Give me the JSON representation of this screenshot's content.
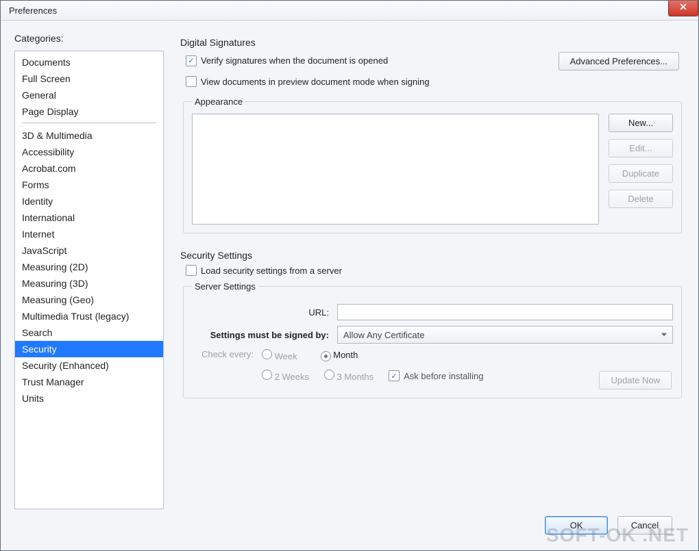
{
  "window": {
    "title": "Preferences"
  },
  "sidebar": {
    "label": "Categories:",
    "group1": [
      "Documents",
      "Full Screen",
      "General",
      "Page Display"
    ],
    "group2": [
      "3D & Multimedia",
      "Accessibility",
      "Acrobat.com",
      "Forms",
      "Identity",
      "International",
      "Internet",
      "JavaScript",
      "Measuring (2D)",
      "Measuring (3D)",
      "Measuring (Geo)",
      "Multimedia Trust (legacy)",
      "Search",
      "Security",
      "Security (Enhanced)",
      "Trust Manager",
      "Units"
    ],
    "selected": "Security"
  },
  "digital": {
    "title": "Digital Signatures",
    "verify_label": "Verify signatures when the document is opened",
    "verify_checked": true,
    "preview_label": "View documents in preview document mode when signing",
    "preview_checked": false,
    "advanced_btn": "Advanced Preferences...",
    "appearance_title": "Appearance",
    "new_btn": "New...",
    "edit_btn": "Edit...",
    "duplicate_btn": "Duplicate",
    "delete_btn": "Delete"
  },
  "security": {
    "title": "Security Settings",
    "load_label": "Load security settings from a server",
    "load_checked": false,
    "server_title": "Server Settings",
    "url_label": "URL:",
    "url_value": "",
    "signed_label": "Settings must be signed by:",
    "signed_value": "Allow Any Certificate",
    "check_label": "Check every:",
    "radios": {
      "week": "Week",
      "month": "Month",
      "two_weeks": "2 Weeks",
      "three_months": "3 Months"
    },
    "radio_selected": "month",
    "ask_label": "Ask before installing",
    "ask_checked": true,
    "update_btn": "Update Now"
  },
  "footer": {
    "ok": "OK",
    "cancel": "Cancel"
  },
  "watermark": "SOFT-OK .NET"
}
